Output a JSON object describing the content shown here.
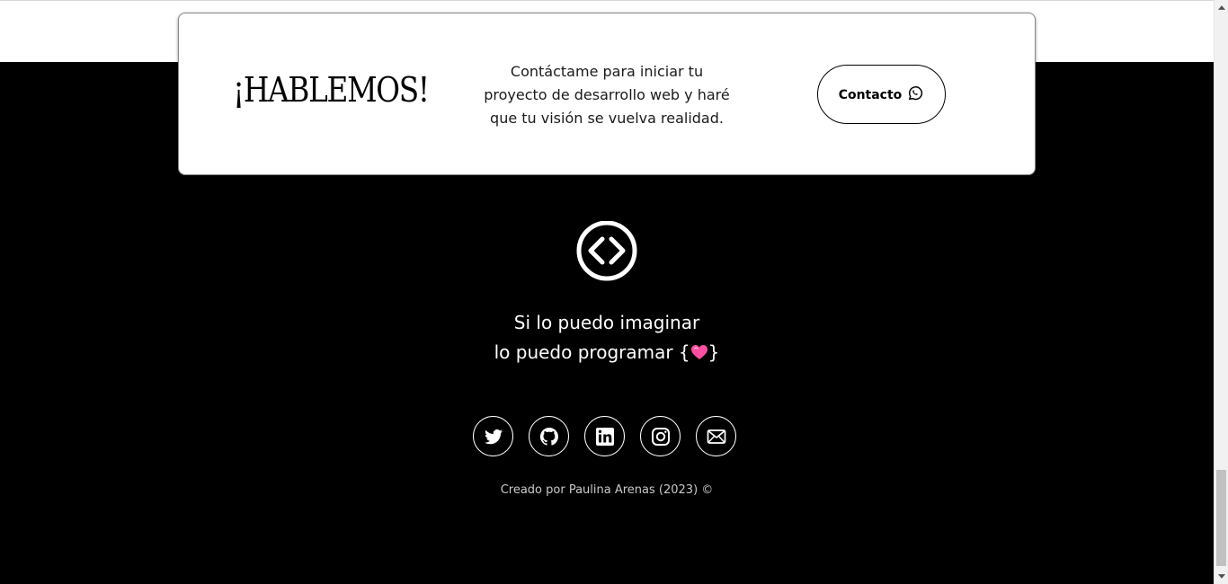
{
  "cta": {
    "title": "¡HABLEMOS!",
    "text": "Contáctame para iniciar tu proyecto de desarrollo web y haré que tu visión se vuelva realidad.",
    "button_label": "Contacto",
    "button_icon": "whatsapp-icon"
  },
  "footer": {
    "logo_icon": "code-brackets-icon",
    "motto_line1": "Si lo puedo imaginar",
    "motto_line2_prefix": "lo puedo programar {",
    "motto_line2_suffix": "}",
    "motto_emoji": "pink-heart-icon",
    "socials": [
      {
        "icon": "twitter-icon"
      },
      {
        "icon": "github-icon"
      },
      {
        "icon": "linkedin-icon"
      },
      {
        "icon": "instagram-icon"
      },
      {
        "icon": "mail-icon"
      }
    ],
    "credits": "Creado por Paulina Arenas (2023) ©"
  },
  "colors": {
    "footer_bg": "#000000",
    "card_bg": "#ffffff",
    "heart": "#ff4fa3"
  }
}
